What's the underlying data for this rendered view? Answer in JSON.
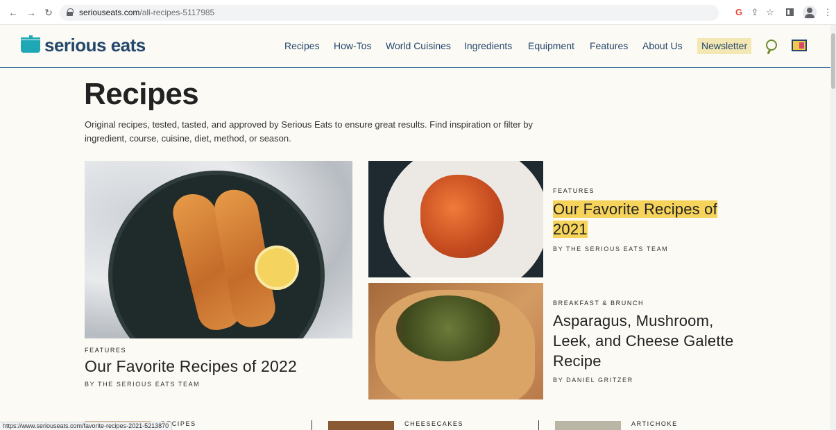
{
  "browser": {
    "url_host": "seriouseats.com",
    "url_path": "/all-recipes-5117985",
    "status_url": "https://www.seriouseats.com/favorite-recipes-2021-5213870"
  },
  "site": {
    "logo": "serious eats",
    "nav": [
      "Recipes",
      "How-Tos",
      "World Cuisines",
      "Ingredients",
      "Equipment",
      "Features",
      "About Us"
    ],
    "newsletter": "Newsletter",
    "colors": {
      "brand": "#24466b",
      "teal": "#1ea7b4",
      "highlight": "#f6d35a"
    }
  },
  "page": {
    "title": "Recipes",
    "description": "Original recipes, tested, tasted, and approved by Serious Eats to ensure great results. Find inspiration or filter by ingredient, course, cuisine, diet, method, or season."
  },
  "cards": [
    {
      "kicker": "FEATURES",
      "title": "Our Favorite Recipes of 2022",
      "byline": "BY THE SERIOUS EATS TEAM"
    },
    {
      "kicker": "FEATURES",
      "title": "Our Favorite Recipes of 2021",
      "byline": "BY THE SERIOUS EATS TEAM"
    },
    {
      "kicker": "BREAKFAST & BRUNCH",
      "title": "Asparagus, Mushroom, Leek, and Cheese Galette Recipe",
      "byline": "BY DANIEL GRITZER"
    }
  ],
  "bottom_row": [
    {
      "kicker": "RECIPES"
    },
    {
      "kicker": "CHEESECAKES"
    },
    {
      "kicker": "ARTICHOKE"
    }
  ]
}
